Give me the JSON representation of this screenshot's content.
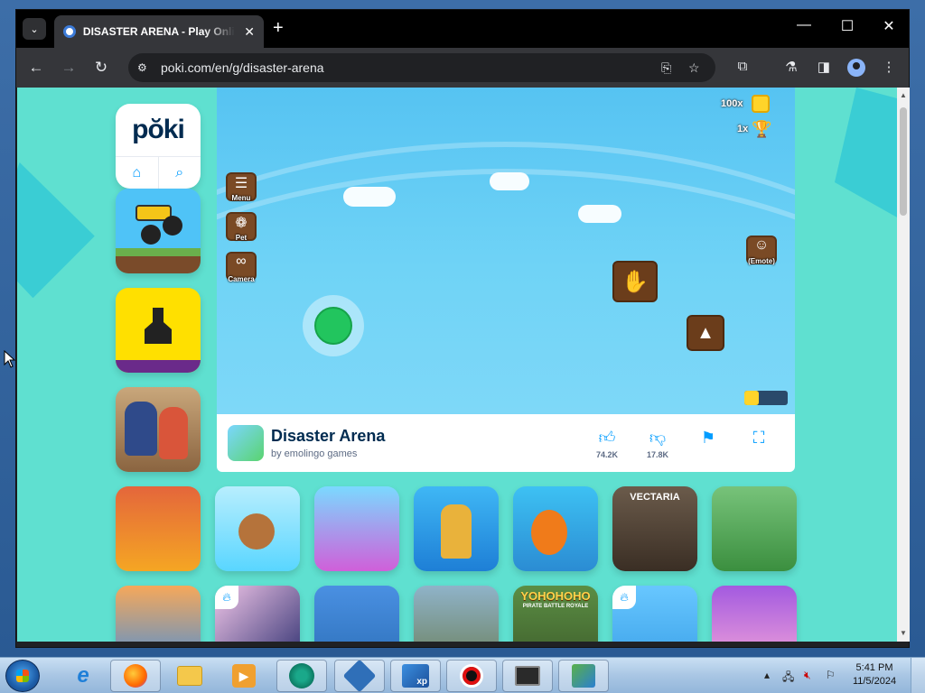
{
  "browser": {
    "tab_title": "DISASTER ARENA - Play Online",
    "tab_close": "✕",
    "new_tab": "+",
    "url": "poki.com/en/g/disaster-arena",
    "window_controls": {
      "minimize": "—",
      "maximize": "☐",
      "close": "✕"
    }
  },
  "site": {
    "logo": "pŏki",
    "nav": {
      "home_icon": "home-icon",
      "search_icon": "search-icon"
    }
  },
  "game": {
    "hud": {
      "coins": "100x",
      "trophies": "1x"
    },
    "buttons": {
      "menu": "Menu",
      "pet": "Pet",
      "camera": "Camera",
      "emote": "(Emote)"
    }
  },
  "game_info": {
    "title": "Disaster Arena",
    "developer": "by emolingo games",
    "likes": "74.2K",
    "dislikes": "17.8K"
  },
  "thumbnails": {
    "row1": [
      "",
      "",
      "",
      "",
      "",
      "VECTARIA",
      ""
    ],
    "row2": [
      "",
      "",
      "",
      "",
      "YOHOHOHO",
      "",
      ""
    ],
    "row2_sub": "PIRATE BATTLE ROYALE"
  },
  "colors": {
    "page_bg": "#5fe0d0",
    "poki_blue": "#009cff",
    "poki_navy": "#002b50",
    "sky": "#56c3f2"
  },
  "taskbar": {
    "time": "5:41 PM",
    "date": "11/5/2024",
    "xp_label": "xp"
  }
}
